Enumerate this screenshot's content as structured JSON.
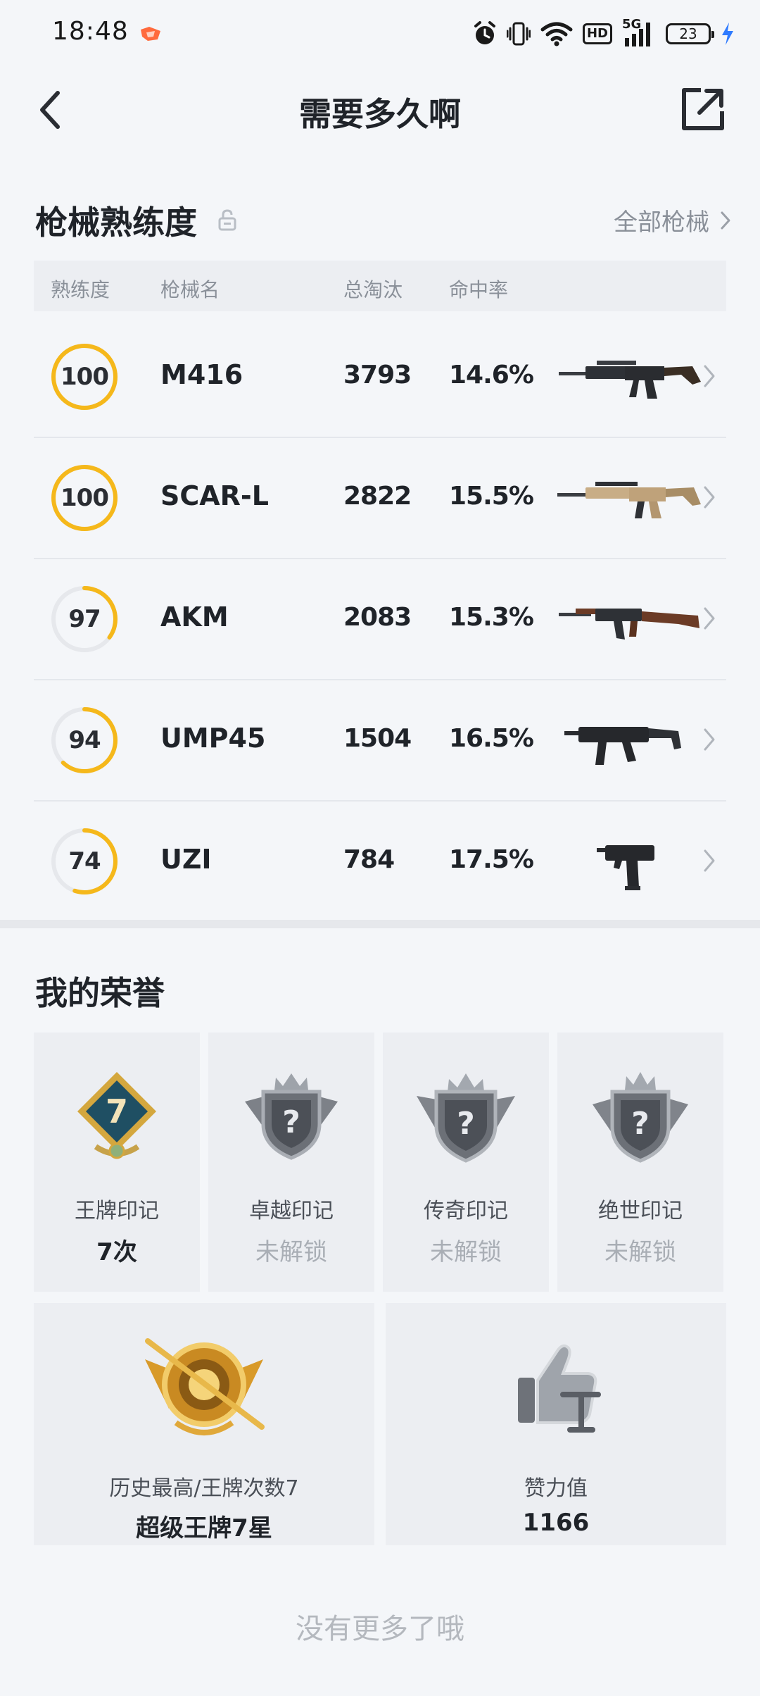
{
  "status_bar": {
    "time": "18:48",
    "battery": "23",
    "hd": "HD",
    "network": "5G",
    "icons": [
      "app-notification-icon",
      "alarm-icon",
      "vibrate-icon",
      "wifi-icon",
      "hd-icon",
      "signal-icon",
      "battery-icon",
      "charging-icon"
    ]
  },
  "header": {
    "title": "需要多久啊",
    "back_icon": "chevron-left-icon",
    "share_icon": "share-icon"
  },
  "weapons": {
    "section_title": "枪械熟练度",
    "lock_icon": "lock-open-icon",
    "all_link": "全部枪械",
    "columns": [
      "熟练度",
      "枪械名",
      "总淘汰",
      "命中率"
    ],
    "accent_color": "#f5b81b",
    "rows": [
      {
        "proficiency": "100",
        "progress": 1.0,
        "name": "M416",
        "kills": "3793",
        "hit_rate": "14.6%",
        "icon": "m416-rifle-icon"
      },
      {
        "proficiency": "100",
        "progress": 1.0,
        "name": "SCAR-L",
        "kills": "2822",
        "hit_rate": "15.5%",
        "icon": "scar-l-rifle-icon"
      },
      {
        "proficiency": "97",
        "progress": 0.35,
        "name": "AKM",
        "kills": "2083",
        "hit_rate": "15.3%",
        "icon": "akm-rifle-icon"
      },
      {
        "proficiency": "94",
        "progress": 0.62,
        "name": "UMP45",
        "kills": "1504",
        "hit_rate": "16.5%",
        "icon": "ump45-smg-icon"
      },
      {
        "proficiency": "74",
        "progress": 0.55,
        "name": "UZI",
        "kills": "784",
        "hit_rate": "17.5%",
        "icon": "uzi-smg-icon"
      }
    ]
  },
  "honors": {
    "section_title": "我的荣誉",
    "marks": [
      {
        "label": "王牌印记",
        "value": "7次",
        "locked": false,
        "badge_number": "7",
        "icon": "ace-mark-badge-icon"
      },
      {
        "label": "卓越印记",
        "value": "未解锁",
        "locked": true,
        "badge_number": "?",
        "icon": "excellence-mark-badge-icon"
      },
      {
        "label": "传奇印记",
        "value": "未解锁",
        "locked": true,
        "badge_number": "?",
        "icon": "legend-mark-badge-icon"
      },
      {
        "label": "绝世印记",
        "value": "未解锁",
        "locked": true,
        "badge_number": "?",
        "icon": "peerless-mark-badge-icon"
      }
    ],
    "history": {
      "label": "历史最高/王牌次数7",
      "value": "超级王牌7星",
      "icon": "super-ace-rank-badge-icon"
    },
    "likes": {
      "label": "赞力值",
      "value": "1166",
      "icon": "thumbs-up-icon"
    }
  },
  "footer": {
    "text": "没有更多了哦"
  }
}
